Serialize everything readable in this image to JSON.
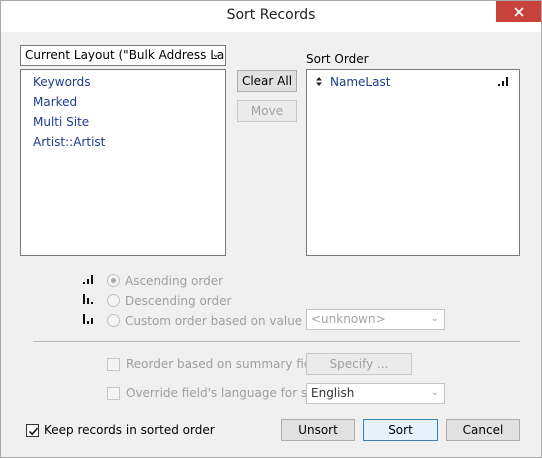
{
  "window": {
    "title": "Sort Records"
  },
  "layout_select": {
    "value": "Current Layout (\"Bulk Address Lab"
  },
  "fields_list": {
    "items": [
      {
        "label": "Keywords"
      },
      {
        "label": "Marked"
      },
      {
        "label": "Multi Site"
      },
      {
        "label": "Artist::Artist"
      }
    ]
  },
  "buttons": {
    "clear_all": "Clear All",
    "move": "Move",
    "specify": "Specify ...",
    "unsort": "Unsort",
    "sort": "Sort",
    "cancel": "Cancel"
  },
  "sort_order": {
    "heading": "Sort Order",
    "items": [
      {
        "label": "NameLast",
        "order_icon": "ascending-icon"
      }
    ]
  },
  "order_options": {
    "ascending": "Ascending order",
    "descending": "Descending order",
    "custom": "Custom order based on value list",
    "custom_select_value": "<unknown>",
    "selected": "ascending"
  },
  "options": {
    "reorder_summary": "Reorder based on summary field",
    "override_language": "Override field's language for sort",
    "language_value": "English",
    "keep_sorted": "Keep records in sorted order",
    "keep_sorted_checked": true
  },
  "colors": {
    "close_button": "#c7423a",
    "field_text": "#1f3d8a",
    "default_button_border": "#3c7fb1"
  }
}
